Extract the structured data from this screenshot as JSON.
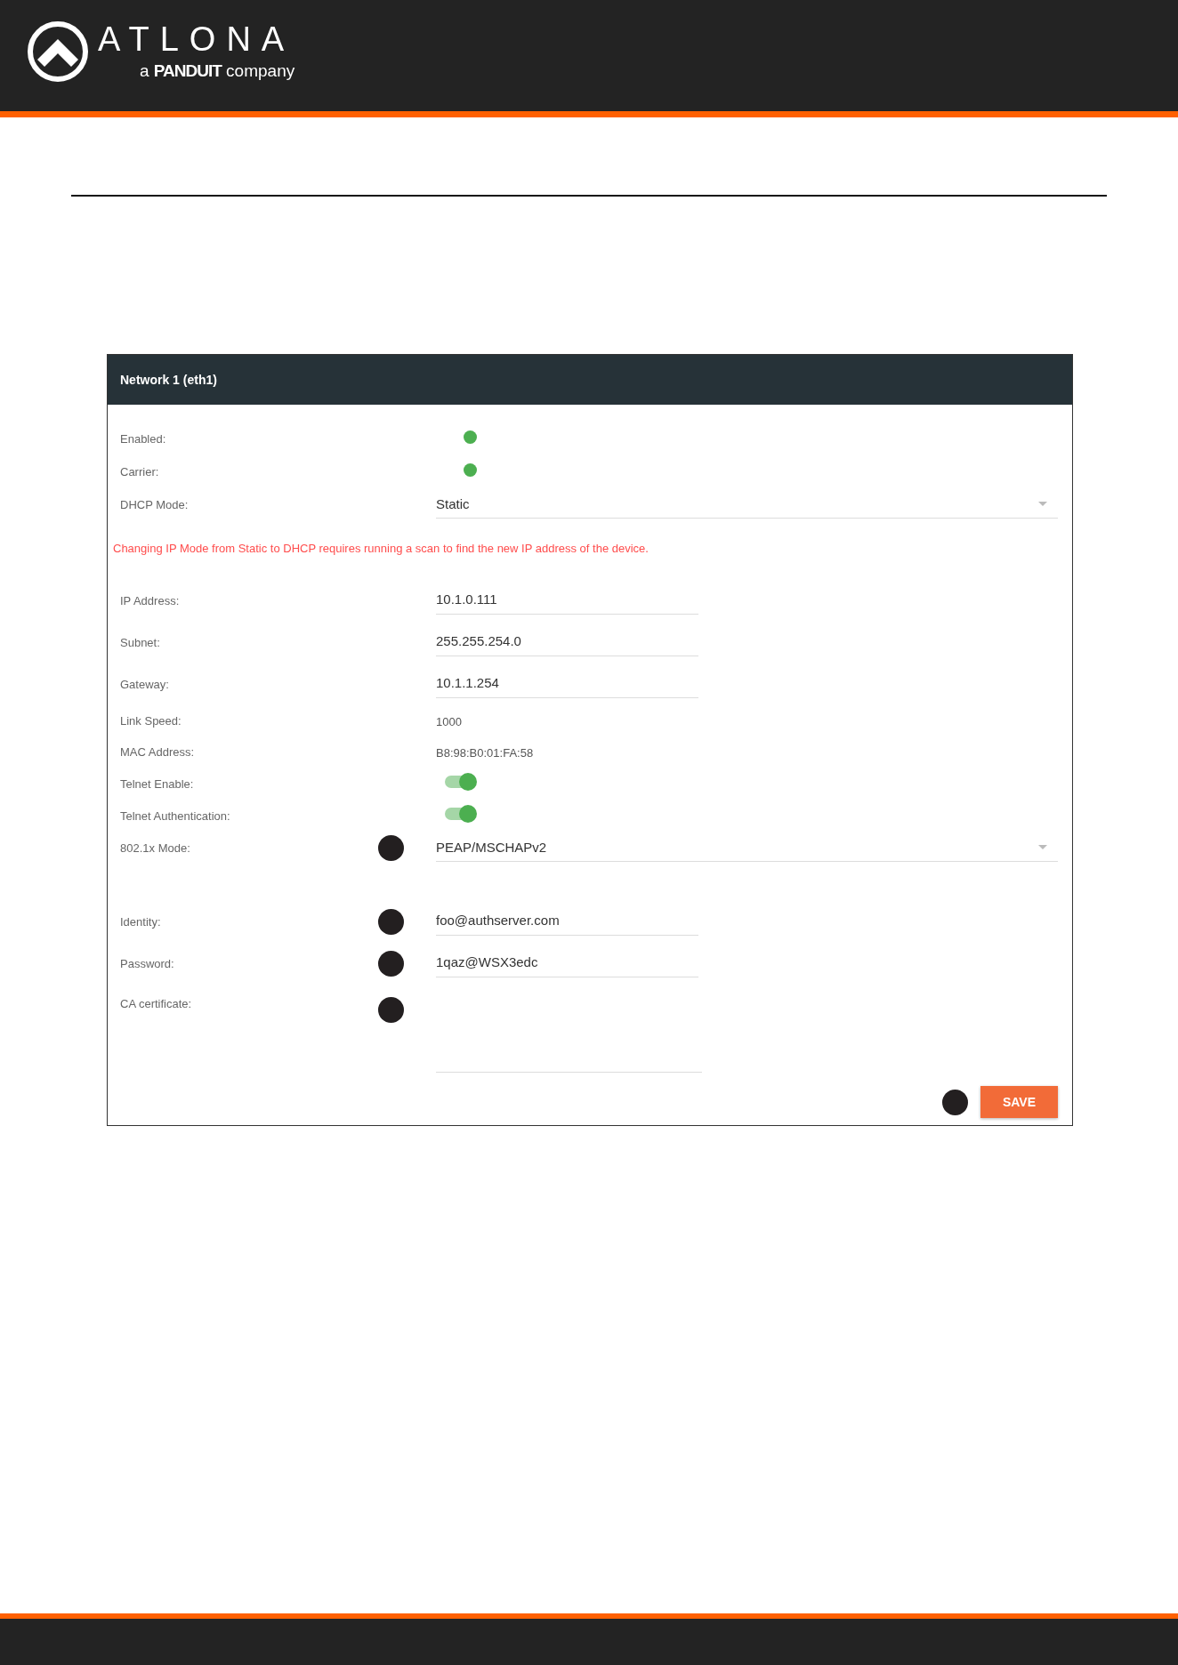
{
  "header": {
    "brand": "ATLONA",
    "tagline_prefix": "a",
    "tagline_brand": "PANDUIT",
    "tagline_suffix": "company"
  },
  "panel": {
    "title": "Network 1 (eth1)",
    "status_rows": [
      {
        "kind": "status",
        "label": "Enabled:",
        "on": true,
        "callout": false
      },
      {
        "kind": "status",
        "label": "Carrier:",
        "on": true,
        "callout": false
      },
      {
        "kind": "select",
        "label": "DHCP Mode:",
        "value": "Static",
        "callout": false
      }
    ],
    "warning": "Changing IP Mode from Static to DHCP requires running a scan to find the new IP address of the device.",
    "rows": [
      {
        "kind": "field",
        "label": "IP Address:",
        "value": "10.1.0.111",
        "callout": false
      },
      {
        "kind": "field",
        "label": "Subnet:",
        "value": "255.255.254.0",
        "callout": false
      },
      {
        "kind": "field",
        "label": "Gateway:",
        "value": "10.1.1.254",
        "callout": false
      },
      {
        "kind": "readonly",
        "label": "Link Speed:",
        "value": "1000",
        "callout": false
      },
      {
        "kind": "readonly",
        "label": "MAC Address:",
        "value": "B8:98:B0:01:FA:58",
        "callout": false
      },
      {
        "kind": "toggle",
        "label": "Telnet Enable:",
        "on": true,
        "callout": false
      },
      {
        "kind": "toggle",
        "label": "Telnet Authentication:",
        "on": true,
        "callout": false
      },
      {
        "kind": "select",
        "label": "802.1x Mode:",
        "value": "PEAP/MSCHAPv2",
        "callout": true
      }
    ],
    "auth_rows": [
      {
        "kind": "field",
        "label": "Identity:",
        "value": "foo@authserver.com",
        "callout": true
      },
      {
        "kind": "field",
        "label": "Password:",
        "value": "1qaz@WSX3edc",
        "callout": true
      },
      {
        "kind": "textarea",
        "label": "CA certificate:",
        "callout": true
      }
    ],
    "save": {
      "label": "SAVE",
      "callout": true
    }
  }
}
